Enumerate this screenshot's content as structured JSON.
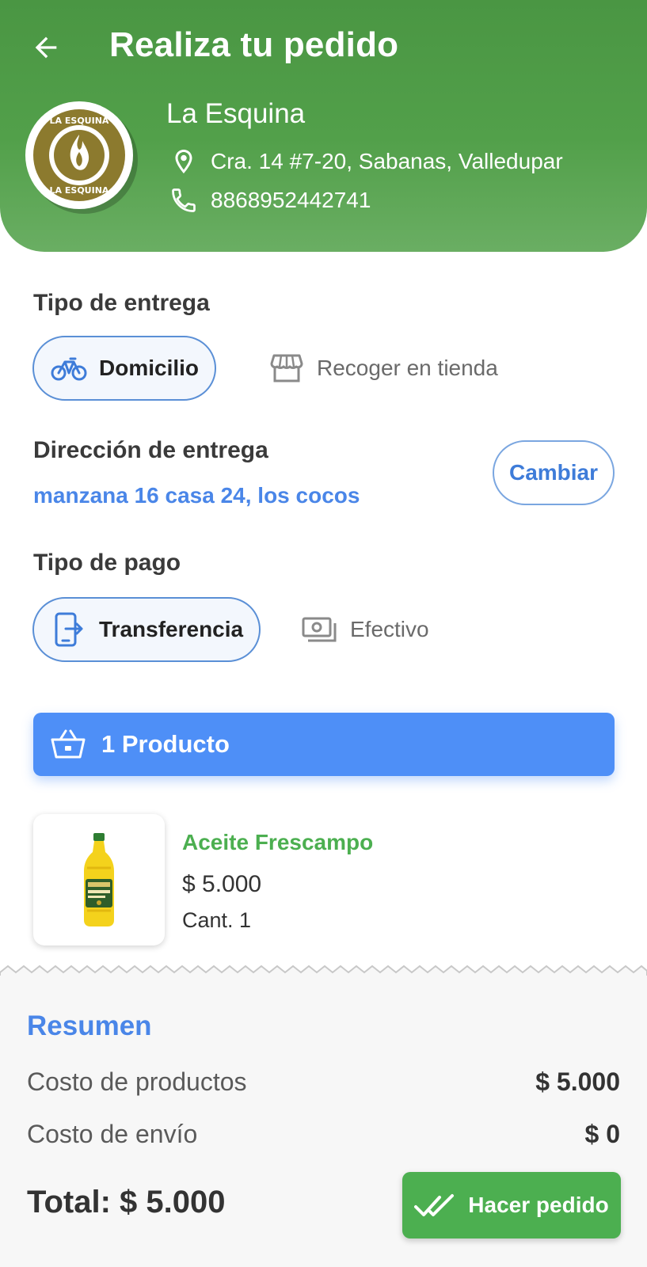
{
  "header": {
    "title": "Realiza tu pedido",
    "store": {
      "name": "La Esquina",
      "address": "Cra. 14 #7-20, Sabanas, Valledupar",
      "phone": "8868952442741",
      "logo_text": "LA ESQUINA"
    },
    "icons": {
      "back": "arrow-left-icon",
      "location": "location-pin-icon",
      "phone": "phone-icon"
    }
  },
  "delivery": {
    "title": "Tipo de entrega",
    "options": [
      {
        "label": "Domicilio",
        "icon": "bicycle-icon",
        "selected": true
      },
      {
        "label": "Recoger en tienda",
        "icon": "storefront-icon",
        "selected": false
      }
    ]
  },
  "address": {
    "title": "Dirección de entrega",
    "value": "manzana 16 casa 24, los cocos",
    "change_label": "Cambiar"
  },
  "payment": {
    "title": "Tipo de pago",
    "options": [
      {
        "label": "Transferencia",
        "icon": "mobile-transfer-icon",
        "selected": true
      },
      {
        "label": "Efectivo",
        "icon": "cash-icon",
        "selected": false
      }
    ]
  },
  "cart": {
    "count_label": "1 Producto",
    "icon": "basket-icon",
    "items": [
      {
        "name": "Aceite Frescampo",
        "price": "$ 5.000",
        "quantity": "Cant. 1",
        "image": "oil-bottle-image"
      }
    ]
  },
  "summary": {
    "title": "Resumen",
    "products_cost_label": "Costo de productos",
    "products_cost_value": "$ 5.000",
    "shipping_label": "Costo de envío",
    "shipping_value": "$ 0",
    "total": "Total: $ 5.000",
    "order_button": "Hacer pedido",
    "order_icon": "double-check-icon"
  },
  "colors": {
    "header_green": "#4a9643",
    "accent_blue": "#4e8ff7",
    "link_blue": "#4a86e8",
    "success_green": "#4caf50"
  }
}
